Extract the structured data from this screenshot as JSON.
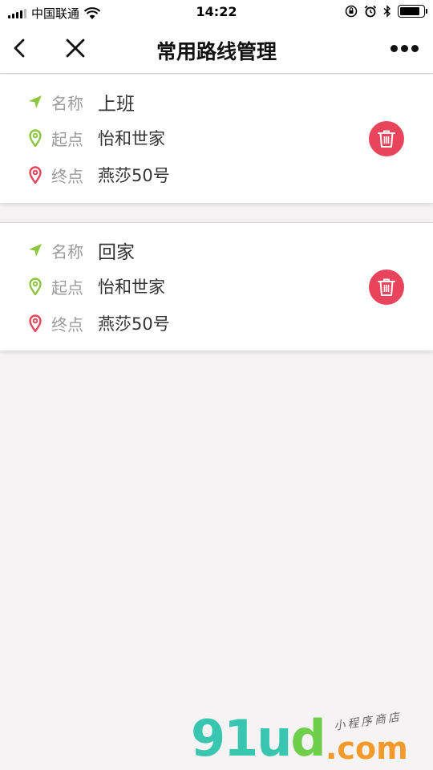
{
  "status_bar": {
    "carrier": "中国联通",
    "time": "14:22"
  },
  "nav": {
    "title": "常用路线管理"
  },
  "labels": {
    "name": "名称",
    "start": "起点",
    "end": "终点"
  },
  "routes": [
    {
      "name": "上班",
      "start": "怡和世家",
      "end": "燕莎50号"
    },
    {
      "name": "回家",
      "start": "怡和世家",
      "end": "燕莎50号"
    }
  ],
  "watermark": {
    "main_a": "91u",
    "main_b": "d",
    "com": ".com",
    "sub": "小程序商店"
  },
  "colors": {
    "accent_green": "#8cc63f",
    "pin_red": "#e8455c",
    "delete_button": "#e8455c",
    "watermark_teal": "#39c6b0",
    "watermark_orange": "#f39a2b"
  },
  "icons": [
    "back-icon",
    "close-icon",
    "more-icon",
    "navigation-arrow-icon",
    "location-pin-icon",
    "trash-icon",
    "wifi-icon",
    "alarm-icon",
    "bluetooth-icon",
    "orientation-lock-icon",
    "battery-icon"
  ]
}
